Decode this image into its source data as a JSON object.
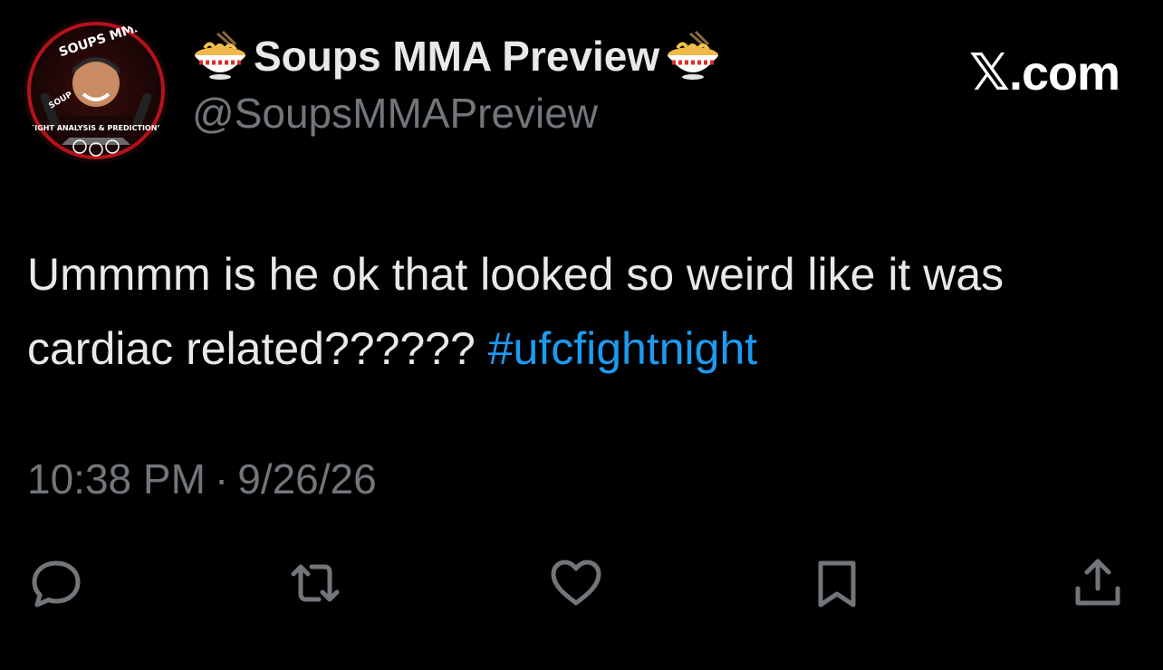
{
  "author": {
    "display_name": "Soups MMA Preview",
    "handle": "@SoupsMMAPreview",
    "avatar_icon": "soups-mma-preview-logo",
    "avatar_texts": {
      "top": "SOUPS MMA PREVIEW",
      "left": "SOUP",
      "bottom": "FIGHT ANALYSIS & PREDICTIONS"
    },
    "name_emoji": "soup-bowl-icon"
  },
  "brand": {
    "x_glyph": "𝕏",
    "suffix": ".com"
  },
  "tweet": {
    "text": "Ummmm is he ok that looked so weird like it was cardiac related?????? ",
    "hashtag": "#ufcfightnight",
    "time": "10:38 PM",
    "separator": "·",
    "date": "9/26/26"
  },
  "actions": [
    {
      "name": "reply",
      "icon": "reply-icon"
    },
    {
      "name": "repost",
      "icon": "repost-icon"
    },
    {
      "name": "like",
      "icon": "heart-icon"
    },
    {
      "name": "bookmark",
      "icon": "bookmark-icon"
    },
    {
      "name": "share",
      "icon": "share-icon"
    }
  ],
  "colors": {
    "background": "#000000",
    "text": "#e7e9ea",
    "secondary": "#71767b",
    "link": "#1d9bf0"
  }
}
